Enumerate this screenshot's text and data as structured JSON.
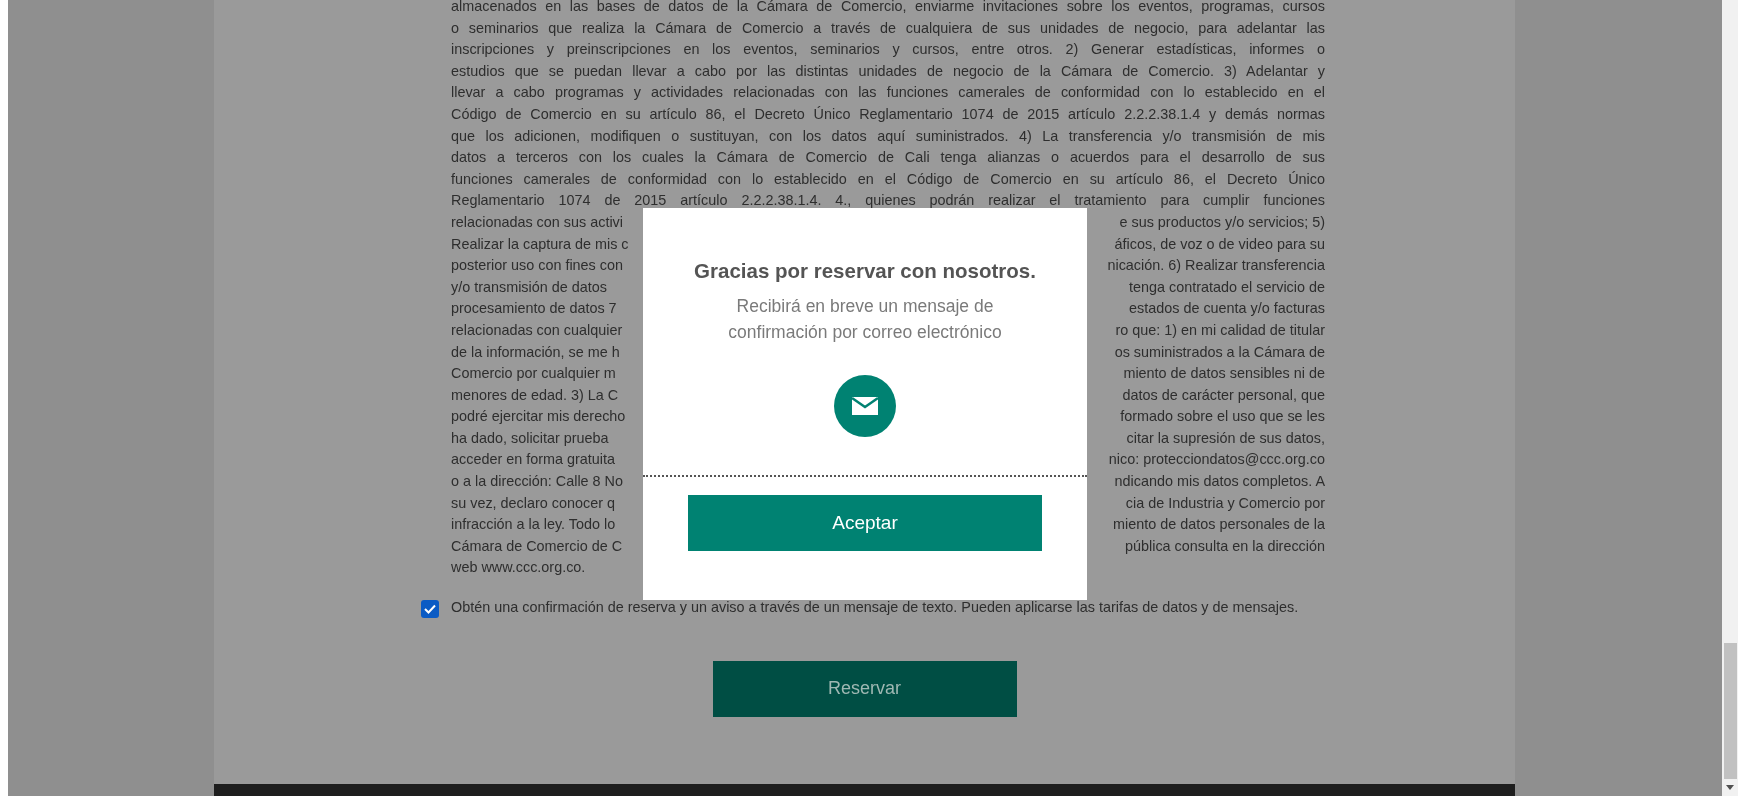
{
  "terms_lines": [
    {
      "kind": "full",
      "text": "almacenados en las bases de datos de la Cámara de Comercio, enviarme invitaciones sobre los eventos, programas, cursos"
    },
    {
      "kind": "full",
      "text": "o seminarios que realiza la Cámara de Comercio a través de cualquiera de sus unidades de negocio, para adelantar las"
    },
    {
      "kind": "full",
      "text": "inscripciones y preinscripciones en los eventos, seminarios y cursos, entre otros. 2) Generar estadísticas, informes o"
    },
    {
      "kind": "full",
      "text": "estudios que se puedan llevar a cabo por las distintas unidades de negocio de la Cámara de Comercio. 3) Adelantar y"
    },
    {
      "kind": "full",
      "text": "llevar a cabo programas y actividades relacionadas con las funciones camerales de conformidad con lo establecido en el"
    },
    {
      "kind": "full",
      "text": "Código de Comercio en su artículo 86, el Decreto Único Reglamentario 1074 de 2015 artículo 2.2.2.38.1.4 y demás normas"
    },
    {
      "kind": "full",
      "text": "que los adicionen, modifiquen o sustituyan, con los datos aquí suministrados. 4) La transferencia y/o transmisión de mis"
    },
    {
      "kind": "full",
      "text": "datos a terceros con los cuales la Cámara de Comercio de Cali tenga alianzas o acuerdos para el desarrollo de sus"
    },
    {
      "kind": "full",
      "text": "funciones camerales de conformidad con lo establecido en el Código de Comercio en su artículo 86, el Decreto Único"
    },
    {
      "kind": "full",
      "text": "Reglamentario 1074 de 2015 artículo 2.2.2.38.1.4. 4., quienes podrán realizar el tratamiento para cumplir funciones"
    },
    {
      "kind": "split",
      "left": "relacionadas con sus activi",
      "right": "e sus productos y/o servicios; 5)"
    },
    {
      "kind": "split",
      "left": "Realizar la captura de mis c",
      "right": "áficos, de voz o de video para su"
    },
    {
      "kind": "split",
      "left": "posterior uso con fines con",
      "right": "nicación. 6) Realizar transferencia"
    },
    {
      "kind": "split",
      "left": "y/o transmisión de datos",
      "right": "tenga contratado el servicio de"
    },
    {
      "kind": "split",
      "left": "procesamiento de datos 7",
      "right": "estados de cuenta y/o facturas"
    },
    {
      "kind": "split",
      "left": "relacionadas con cualquier",
      "right": "ro que: 1) en mi calidad de titular"
    },
    {
      "kind": "split",
      "left": "de la información, se me h",
      "right": "os suministrados a la Cámara de"
    },
    {
      "kind": "split",
      "left": "Comercio por cualquier m",
      "right": "miento de datos sensibles ni de"
    },
    {
      "kind": "split",
      "left": "menores de edad. 3) La C",
      "right": "datos de carácter personal, que"
    },
    {
      "kind": "split",
      "left": "podré ejercitar mis derecho",
      "right": "formado sobre el uso que se les"
    },
    {
      "kind": "split",
      "left": "ha dado, solicitar prueba",
      "right": "citar la supresión de sus datos,"
    },
    {
      "kind": "split",
      "left": "acceder en forma gratuita",
      "right": "nico: protecciondatos@ccc.org.co"
    },
    {
      "kind": "split",
      "left": "o a la dirección: Calle 8 No",
      "right": "ndicando mis datos completos. A"
    },
    {
      "kind": "split",
      "left": "su vez, declaro conocer q",
      "right": "cia de Industria y Comercio por"
    },
    {
      "kind": "split",
      "left": "infracción a la ley. Todo lo",
      "right": "miento de datos personales de la"
    },
    {
      "kind": "split",
      "left": "Cámara de Comercio de C",
      "right": "pública consulta en la dirección"
    },
    {
      "kind": "last",
      "text": "web www.ccc.org.co."
    }
  ],
  "sms_opt_in": {
    "checked": true,
    "label": "Obtén una confirmación de reserva y un aviso a través de un mensaje de texto. Pueden aplicarse las tarifas de datos y de mensajes."
  },
  "submit_button": "Reservar",
  "modal": {
    "title": "Gracias por reservar con nosotros.",
    "message": "Recibirá en breve un mensaje de confirmación por correo electrónico",
    "button": "Aceptar"
  }
}
